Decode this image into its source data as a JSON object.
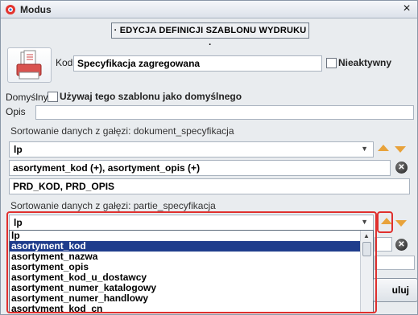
{
  "window": {
    "title": "Modus"
  },
  "heading": "· EDYCJA DEFINICJI SZABLONU WYDRUKU ·",
  "kod": {
    "label": "Kod",
    "value": "Specyfikacja zagregowana"
  },
  "nieaktywny": {
    "label": "Nieaktywny",
    "checked": false
  },
  "domyslny": {
    "label": "Domyślny",
    "checkbox_label": "Używaj tego szablonu jako domyślnego",
    "checked": false
  },
  "opis": {
    "label": "Opis",
    "value": ""
  },
  "sort1": {
    "label": "Sortowanie danych z gałęzi: dokument_specyfikacja",
    "selected": "lp",
    "fields_value": "asortyment_kod (+), asortyment_opis (+)",
    "extra_value": "PRD_KOD, PRD_OPIS"
  },
  "sort2": {
    "label": "Sortowanie danych z gałęzi: partie_specyfikacja",
    "selected": "lp",
    "options": [
      "lp",
      "asortyment_kod",
      "asortyment_nazwa",
      "asortyment_opis",
      "asortyment_kod_u_dostawcy",
      "asortyment_numer_katalogowy",
      "asortyment_numer_handlowy",
      "asortyment_kod_cn"
    ],
    "highlighted_index": 1
  },
  "buttons": {
    "cancel_partial": "uluj"
  },
  "colors": {
    "highlight": "#1f3d8c",
    "annotation": "#e0302e",
    "arrow": "#e8a23a"
  },
  "icons": {
    "app": "modus-app-icon",
    "print": "printer-template-icon",
    "move_up": "arrow-up-icon",
    "move_down": "arrow-down-icon",
    "delete": "delete-icon"
  }
}
